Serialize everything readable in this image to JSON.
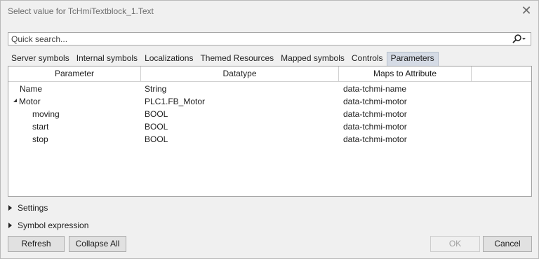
{
  "window": {
    "title": "Select value for TcHmiTextblock_1.Text",
    "close_glyph": "✕"
  },
  "search": {
    "placeholder": "Quick search...",
    "icon": "search-icon"
  },
  "tabs": [
    {
      "label": "Server symbols",
      "active": false
    },
    {
      "label": "Internal symbols",
      "active": false
    },
    {
      "label": "Localizations",
      "active": false
    },
    {
      "label": "Themed Resources",
      "active": false
    },
    {
      "label": "Mapped symbols",
      "active": false
    },
    {
      "label": "Controls",
      "active": false
    },
    {
      "label": "Parameters",
      "active": true
    }
  ],
  "table": {
    "columns": [
      "Parameter",
      "Datatype",
      "Maps to Attribute",
      ""
    ],
    "rows": [
      {
        "parameter": "Name",
        "datatype": "String",
        "attribute": "data-tchmi-name",
        "level": 0,
        "expandable": false
      },
      {
        "parameter": "Motor",
        "datatype": "PLC1.FB_Motor",
        "attribute": "data-tchmi-motor",
        "level": 0,
        "expandable": true,
        "expanded": true
      },
      {
        "parameter": "moving",
        "datatype": "BOOL",
        "attribute": "data-tchmi-motor",
        "level": 1,
        "expandable": false
      },
      {
        "parameter": "start",
        "datatype": "BOOL",
        "attribute": "data-tchmi-motor",
        "level": 1,
        "expandable": false
      },
      {
        "parameter": "stop",
        "datatype": "BOOL",
        "attribute": "data-tchmi-motor",
        "level": 1,
        "expandable": false
      }
    ]
  },
  "sections": {
    "settings": "Settings",
    "symbol_expression": "Symbol expression"
  },
  "buttons": {
    "refresh": "Refresh",
    "collapse_all": "Collapse All",
    "ok": "OK",
    "cancel": "Cancel"
  },
  "colors": {
    "active_tab": "#d5dbe5",
    "border": "#a0a0a0",
    "background": "#f0f0f0"
  }
}
